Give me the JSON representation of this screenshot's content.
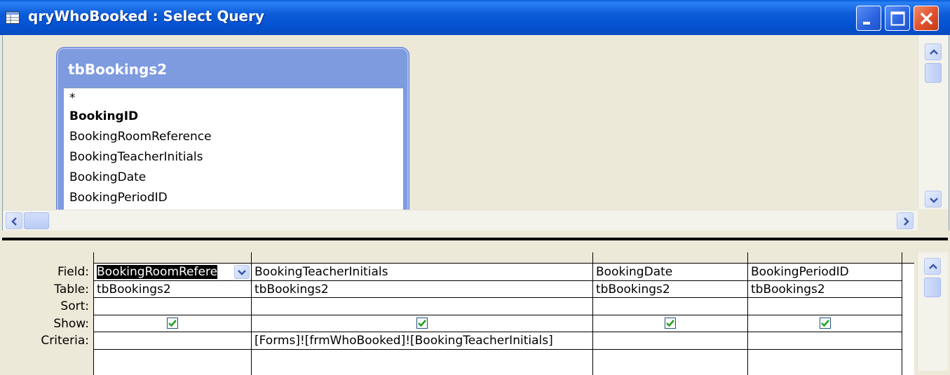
{
  "window": {
    "title": "qryWhoBooked : Select Query",
    "controls": [
      "minimize-icon",
      "maximize-icon",
      "close-icon"
    ]
  },
  "field_list": {
    "title": "tbBookings2",
    "items": [
      {
        "label": "*",
        "bold": false
      },
      {
        "label": "BookingID",
        "bold": true
      },
      {
        "label": "BookingRoomReference",
        "bold": false
      },
      {
        "label": "BookingTeacherInitials",
        "bold": false
      },
      {
        "label": "BookingDate",
        "bold": false
      },
      {
        "label": "BookingPeriodID",
        "bold": false
      }
    ]
  },
  "grid": {
    "row_labels": {
      "field": "Field:",
      "table": "Table:",
      "sort": "Sort:",
      "show": "Show:",
      "criteria": "Criteria:"
    },
    "columns": [
      {
        "field": "BookingRoomReference",
        "field_visible": "BookingRoomRefere",
        "table": "tbBookings2",
        "sort": "",
        "show": true,
        "criteria": ""
      },
      {
        "field": "BookingTeacherInitials",
        "table": "tbBookings2",
        "sort": "",
        "show": true,
        "criteria": "[Forms]![frmWhoBooked]![BookingTeacherInitials]"
      },
      {
        "field": "BookingDate",
        "table": "tbBookings2",
        "sort": "",
        "show": true,
        "criteria": ""
      },
      {
        "field": "BookingPeriodID",
        "table": "tbBookings2",
        "sort": "",
        "show": true,
        "criteria": ""
      }
    ]
  },
  "colors": {
    "titlebar": "#0553D3",
    "field_list_header": "#7E9BE0",
    "window_bg": "#ECE9D8",
    "checkbox_check": "#21A121"
  }
}
